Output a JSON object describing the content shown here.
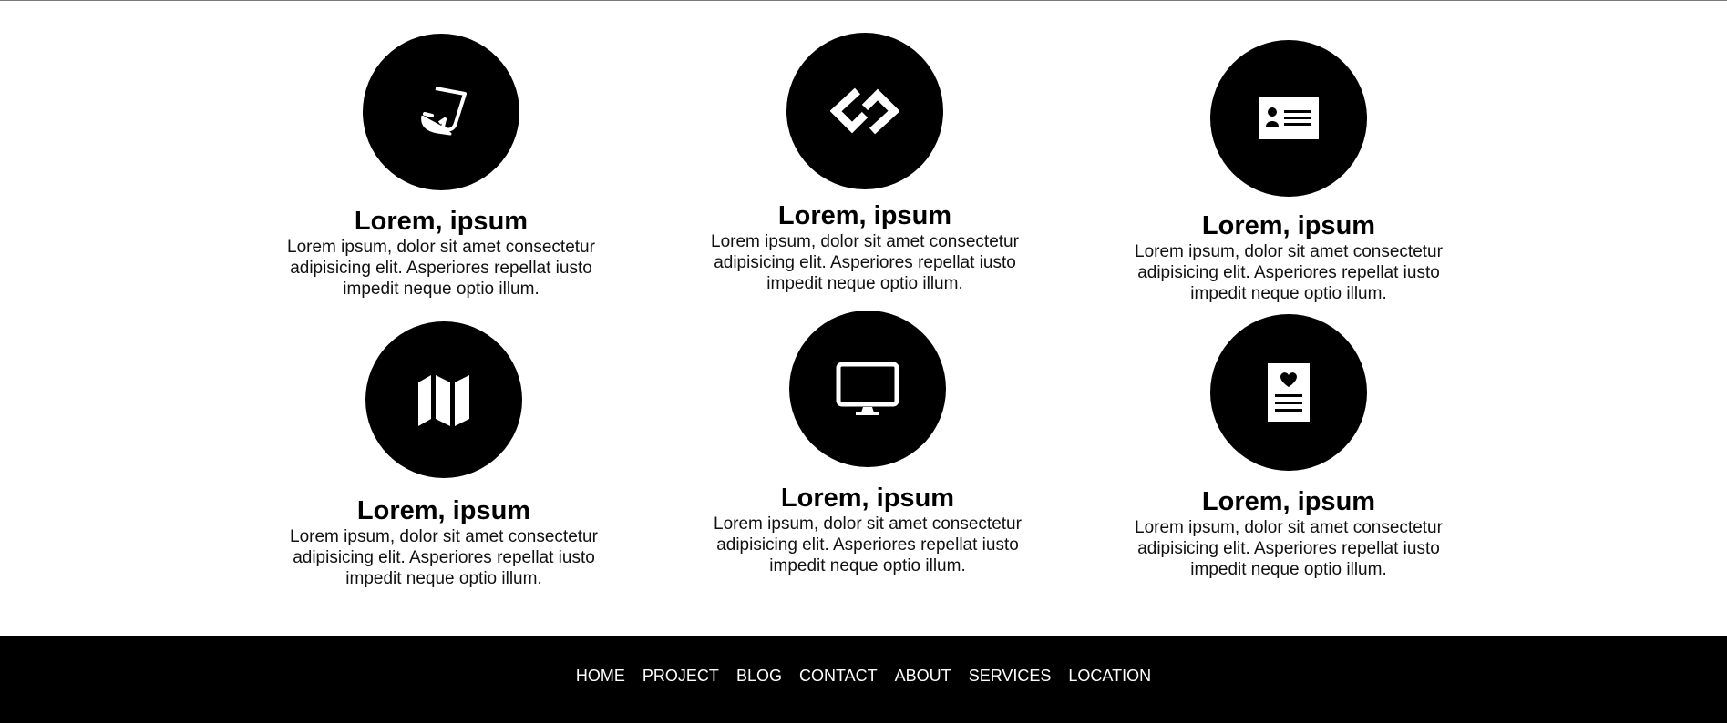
{
  "features": [
    {
      "title": "Lorem, ipsum",
      "text": "Lorem ipsum, dolor sit amet consectetur adipisicing elit. Asperiores repellat iusto impedit neque optio illum.",
      "icon": "scroll-icon"
    },
    {
      "title": "Lorem, ipsum",
      "text": "Lorem ipsum, dolor sit amet consectetur adipisicing elit. Asperiores repellat iusto impedit neque optio illum.",
      "icon": "link-icon"
    },
    {
      "title": "Lorem, ipsum",
      "text": "Lorem ipsum, dolor sit amet consectetur adipisicing elit. Asperiores repellat iusto impedit neque optio illum.",
      "icon": "id-card-icon"
    },
    {
      "title": "Lorem, ipsum",
      "text": "Lorem ipsum, dolor sit amet consectetur adipisicing elit. Asperiores repellat iusto impedit neque optio illum.",
      "icon": "map-icon"
    },
    {
      "title": "Lorem, ipsum",
      "text": "Lorem ipsum, dolor sit amet consectetur adipisicing elit. Asperiores repellat iusto impedit neque optio illum.",
      "icon": "monitor-icon"
    },
    {
      "title": "Lorem, ipsum",
      "text": "Lorem ipsum, dolor sit amet consectetur adipisicing elit. Asperiores repellat iusto impedit neque optio illum.",
      "icon": "heart-document-icon"
    }
  ],
  "footer": {
    "nav": [
      "HOME",
      "PROJECT",
      "BLOG",
      "CONTACT",
      "ABOUT",
      "SERVICES",
      "LOCATION"
    ]
  },
  "colors": {
    "background": "#ffffff",
    "icon_circle": "#000000",
    "footer_bg": "#000000",
    "footer_text": "#ffffff"
  }
}
